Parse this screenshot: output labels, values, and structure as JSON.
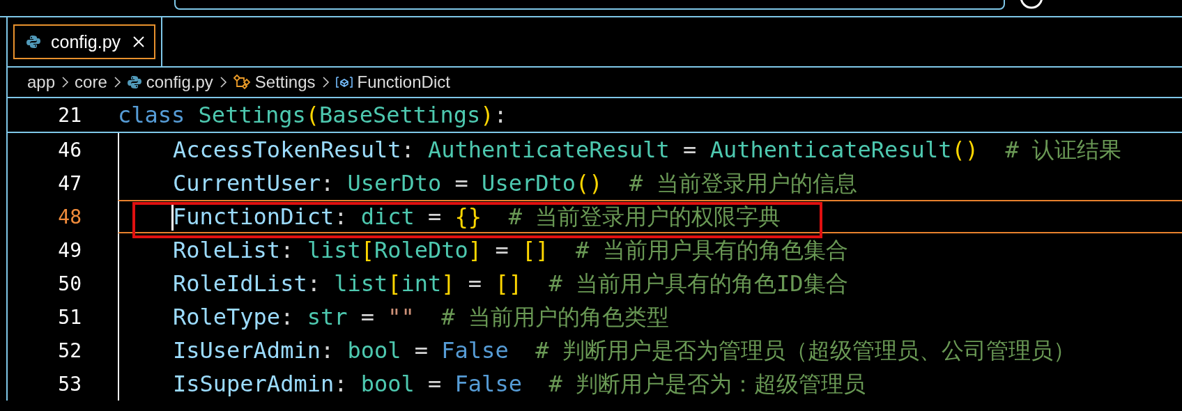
{
  "tabs": [
    {
      "label": "config.py",
      "selected": true
    }
  ],
  "breadcrumb": [
    {
      "label": "app",
      "kind": "folder"
    },
    {
      "label": "core",
      "kind": "folder"
    },
    {
      "label": "config.py",
      "kind": "file"
    },
    {
      "label": "Settings",
      "kind": "class"
    },
    {
      "label": "FunctionDict",
      "kind": "field"
    }
  ],
  "sticky_line": {
    "number": "21",
    "tokens": [
      {
        "text": "class ",
        "kind": "keyword"
      },
      {
        "text": "Settings",
        "kind": "type"
      },
      {
        "text": "(",
        "kind": "bracket"
      },
      {
        "text": "BaseSettings",
        "kind": "type"
      },
      {
        "text": ")",
        "kind": "bracket"
      },
      {
        "text": ":",
        "kind": "punct"
      }
    ]
  },
  "lines": [
    {
      "number": "46",
      "current": false,
      "highlighted": false,
      "tokens": [
        {
          "text": "AccessTokenResult",
          "kind": "variable"
        },
        {
          "text": ": ",
          "kind": "punct"
        },
        {
          "text": "AuthenticateResult",
          "kind": "type"
        },
        {
          "text": " = ",
          "kind": "punct"
        },
        {
          "text": "AuthenticateResult",
          "kind": "type"
        },
        {
          "text": "()",
          "kind": "bracket"
        },
        {
          "text": "# 认证结果",
          "kind": "comment"
        }
      ]
    },
    {
      "number": "47",
      "current": false,
      "highlighted": false,
      "tokens": [
        {
          "text": "CurrentUser",
          "kind": "variable"
        },
        {
          "text": ": ",
          "kind": "punct"
        },
        {
          "text": "UserDto",
          "kind": "type"
        },
        {
          "text": " = ",
          "kind": "punct"
        },
        {
          "text": "UserDto",
          "kind": "type"
        },
        {
          "text": "()",
          "kind": "bracket"
        },
        {
          "text": "# 当前登录用户的信息",
          "kind": "comment"
        }
      ]
    },
    {
      "number": "48",
      "current": true,
      "highlighted": true,
      "tokens": [
        {
          "text": "FunctionDict",
          "kind": "variable"
        },
        {
          "text": ": ",
          "kind": "punct"
        },
        {
          "text": "dict",
          "kind": "type"
        },
        {
          "text": " = ",
          "kind": "punct"
        },
        {
          "text": "{}",
          "kind": "bracket"
        },
        {
          "text": "# 当前登录用户的权限字典",
          "kind": "comment"
        }
      ]
    },
    {
      "number": "49",
      "current": false,
      "highlighted": false,
      "tokens": [
        {
          "text": "RoleList",
          "kind": "variable"
        },
        {
          "text": ": ",
          "kind": "punct"
        },
        {
          "text": "list",
          "kind": "type"
        },
        {
          "text": "[",
          "kind": "bracket"
        },
        {
          "text": "RoleDto",
          "kind": "type"
        },
        {
          "text": "]",
          "kind": "bracket"
        },
        {
          "text": " = ",
          "kind": "punct"
        },
        {
          "text": "[]",
          "kind": "bracket"
        },
        {
          "text": "# 当前用户具有的角色集合",
          "kind": "comment"
        }
      ]
    },
    {
      "number": "50",
      "current": false,
      "highlighted": false,
      "tokens": [
        {
          "text": "RoleIdList",
          "kind": "variable"
        },
        {
          "text": ": ",
          "kind": "punct"
        },
        {
          "text": "list",
          "kind": "type"
        },
        {
          "text": "[",
          "kind": "bracket"
        },
        {
          "text": "int",
          "kind": "type"
        },
        {
          "text": "]",
          "kind": "bracket"
        },
        {
          "text": " = ",
          "kind": "punct"
        },
        {
          "text": "[]",
          "kind": "bracket"
        },
        {
          "text": "# 当前用户具有的角色ID集合",
          "kind": "comment"
        }
      ]
    },
    {
      "number": "51",
      "current": false,
      "highlighted": false,
      "tokens": [
        {
          "text": "RoleType",
          "kind": "variable"
        },
        {
          "text": ": ",
          "kind": "punct"
        },
        {
          "text": "str",
          "kind": "type"
        },
        {
          "text": " = ",
          "kind": "punct"
        },
        {
          "text": "\"\"",
          "kind": "string"
        },
        {
          "text": "# 当前用户的角色类型",
          "kind": "comment"
        }
      ]
    },
    {
      "number": "52",
      "current": false,
      "highlighted": false,
      "tokens": [
        {
          "text": "IsUserAdmin",
          "kind": "variable"
        },
        {
          "text": ": ",
          "kind": "punct"
        },
        {
          "text": "bool",
          "kind": "type"
        },
        {
          "text": " = ",
          "kind": "punct"
        },
        {
          "text": "False",
          "kind": "constant"
        },
        {
          "text": "# 判断用户是否为管理员（超级管理员、公司管理员）",
          "kind": "comment"
        }
      ]
    },
    {
      "number": "53",
      "current": false,
      "highlighted": false,
      "tokens": [
        {
          "text": "IsSuperAdmin",
          "kind": "variable"
        },
        {
          "text": ": ",
          "kind": "punct"
        },
        {
          "text": "bool",
          "kind": "type"
        },
        {
          "text": " = ",
          "kind": "punct"
        },
        {
          "text": "False",
          "kind": "constant"
        },
        {
          "text": "# 判断用户是否为：超级管理员",
          "kind": "comment"
        }
      ]
    }
  ]
}
